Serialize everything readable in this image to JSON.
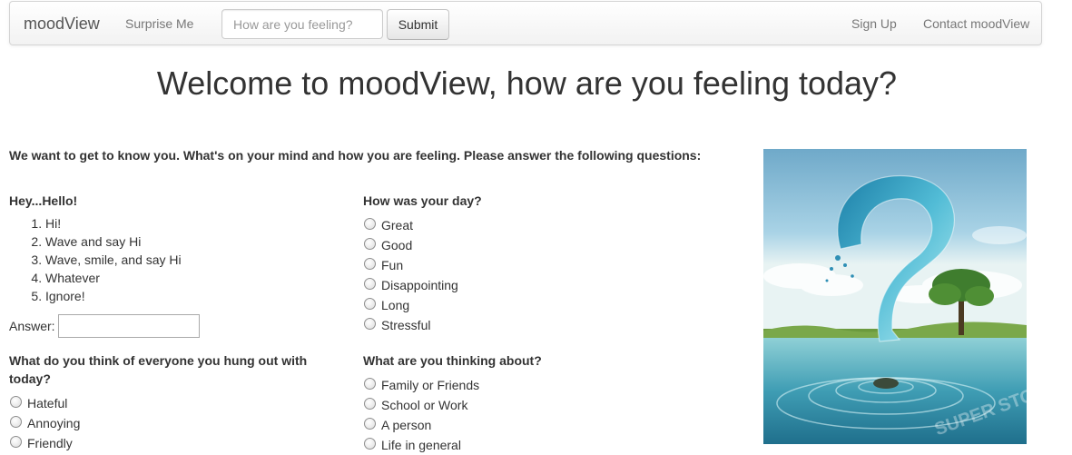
{
  "navbar": {
    "brand": "moodView",
    "surprise_label": "Surprise Me",
    "search_placeholder": "How are you feeling?",
    "submit_label": "Submit",
    "signup_label": "Sign Up",
    "contact_label": "Contact moodView"
  },
  "page_title": "Welcome to moodView, how are you feeling today?",
  "intro": "We want to get to know you. What's on your mind and how you are feeling. Please answer the following questions:",
  "q1": {
    "title": "Hey...Hello!",
    "options": [
      "Hi!",
      "Wave and say Hi",
      "Wave, smile, and say Hi",
      "Whatever",
      "Ignore!"
    ],
    "answer_label": "Answer:",
    "answer_value": ""
  },
  "q2": {
    "title": "How was your day?",
    "options": [
      "Great",
      "Good",
      "Fun",
      "Disappointing",
      "Long",
      "Stressful"
    ]
  },
  "q3": {
    "title": "What do you think of everyone you hung out with today?",
    "options": [
      "Hateful",
      "Annoying",
      "Friendly"
    ]
  },
  "q4": {
    "title": "What are you thinking about?",
    "options": [
      "Family or Friends",
      "School or Work",
      "A person",
      "Life in general"
    ]
  },
  "picture": {
    "description_icon": "question-mark-water-illustration",
    "watermark": "SUPER STOCK"
  },
  "colors": {
    "navbar_bg": "#f5f5f5",
    "nav_text": "#777777",
    "body_text": "#333333"
  }
}
